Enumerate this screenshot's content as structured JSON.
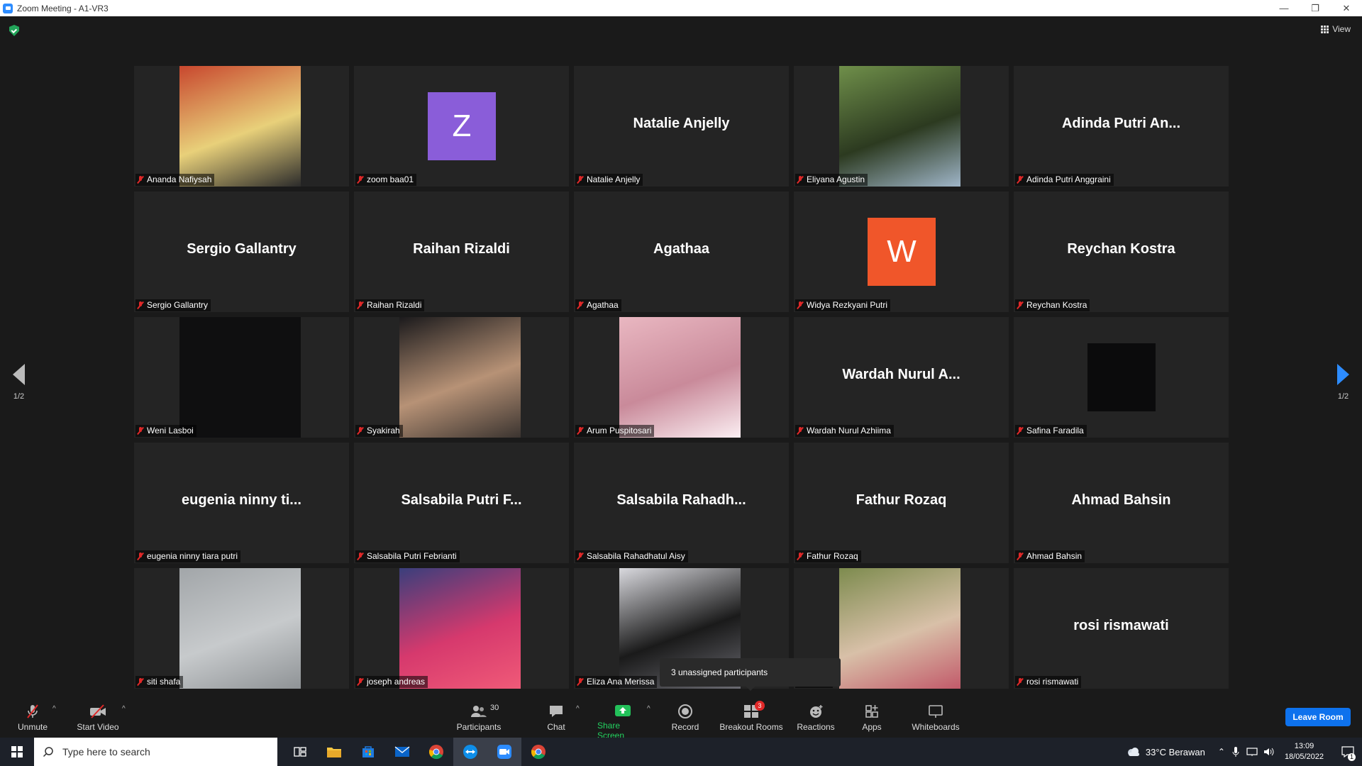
{
  "window": {
    "title": "Zoom Meeting - A1-VR3"
  },
  "top_bar": {
    "view_label": "View"
  },
  "pagination": {
    "left": "1/2",
    "right": "1/2"
  },
  "tiles": [
    {
      "name": "Ananda Nafiysah",
      "display": "",
      "type": "photo",
      "colors": [
        "#c8472e",
        "#e8d07a",
        "#2b2b2b"
      ]
    },
    {
      "name": "zoom baa01",
      "display": "Z",
      "type": "avatar",
      "avatar_color": "#8a5dd9"
    },
    {
      "name": "Natalie Anjelly",
      "display": "Natalie Anjelly",
      "type": "text"
    },
    {
      "name": "Eliyana Agustin",
      "display": "",
      "type": "photo",
      "colors": [
        "#6f8f4a",
        "#2c3a20",
        "#9fb5c8"
      ]
    },
    {
      "name": "Adinda Putri Anggraini",
      "display": "Adinda Putri An...",
      "type": "text"
    },
    {
      "name": "Sergio Gallantry",
      "display": "Sergio Gallantry",
      "type": "text"
    },
    {
      "name": "Raihan Rizaldi",
      "display": "Raihan Rizaldi",
      "type": "text"
    },
    {
      "name": "Agathaa",
      "display": "Agathaa",
      "type": "text"
    },
    {
      "name": "Widya Rezkyani Putri",
      "display": "W",
      "type": "avatar",
      "avatar_color": "#f0562a"
    },
    {
      "name": "Reychan Kostra",
      "display": "Reychan Kostra",
      "type": "text"
    },
    {
      "name": "Weni Lasboi",
      "display": "",
      "type": "photo",
      "colors": [
        "#0f0f10",
        "#0f0f10",
        "#0f0f10"
      ]
    },
    {
      "name": "Syakirah",
      "display": "",
      "type": "photo",
      "colors": [
        "#1b1a1c",
        "#b79276",
        "#3b3430"
      ]
    },
    {
      "name": "Arum Puspitosari",
      "display": "",
      "type": "photo",
      "colors": [
        "#e9b7c1",
        "#c98a9a",
        "#fbeef2"
      ]
    },
    {
      "name": "Wardah Nurul Azhiima",
      "display": "Wardah Nurul A...",
      "type": "text"
    },
    {
      "name": "Safina Faradila",
      "display": "",
      "type": "square",
      "colors": [
        "#0b0b0c",
        "#0b0b0c",
        "#0b0b0c"
      ]
    },
    {
      "name": "eugenia ninny tiara putri",
      "display": "eugenia ninny ti...",
      "type": "text"
    },
    {
      "name": "Salsabila Putri Febrianti",
      "display": "Salsabila Putri F...",
      "type": "text"
    },
    {
      "name": "Salsabila Rahadhatul Aisy",
      "display": "Salsabila  Rahadh...",
      "type": "text"
    },
    {
      "name": "Fathur Rozaq",
      "display": "Fathur Rozaq",
      "type": "text"
    },
    {
      "name": "Ahmad Bahsin",
      "display": "Ahmad Bahsin",
      "type": "text"
    },
    {
      "name": "siti shafa",
      "display": "",
      "type": "photo",
      "colors": [
        "#a2a6a9",
        "#c7cacc",
        "#8f9396"
      ]
    },
    {
      "name": "joseph andreas",
      "display": "",
      "type": "photo",
      "colors": [
        "#3a3f7c",
        "#d6396d",
        "#f05a78"
      ]
    },
    {
      "name": "Eliza Ana Merissa",
      "display": "",
      "type": "photo",
      "colors": [
        "#d9d9de",
        "#1a1a1a",
        "#6b6b72"
      ]
    },
    {
      "name": "handa",
      "display": "",
      "type": "photo",
      "colors": [
        "#7d8b4e",
        "#d8c0a8",
        "#c25a6a"
      ]
    },
    {
      "name": "rosi rismawati",
      "display": "rosi rismawati",
      "type": "text"
    }
  ],
  "tooltip": "3 unassigned participants",
  "toolbar": {
    "unmute": "Unmute",
    "start_video": "Start Video",
    "participants": "Participants",
    "participants_count": "30",
    "chat": "Chat",
    "share_screen": "Share Screen",
    "record": "Record",
    "breakout_rooms": "Breakout Rooms",
    "breakout_badge": "3",
    "reactions": "Reactions",
    "apps": "Apps",
    "whiteboards": "Whiteboards",
    "leave_room": "Leave Room"
  },
  "taskbar": {
    "search_placeholder": "Type here to search",
    "weather": "33°C  Berawan",
    "time": "13:09",
    "date": "18/05/2022",
    "notification_count": "1"
  }
}
